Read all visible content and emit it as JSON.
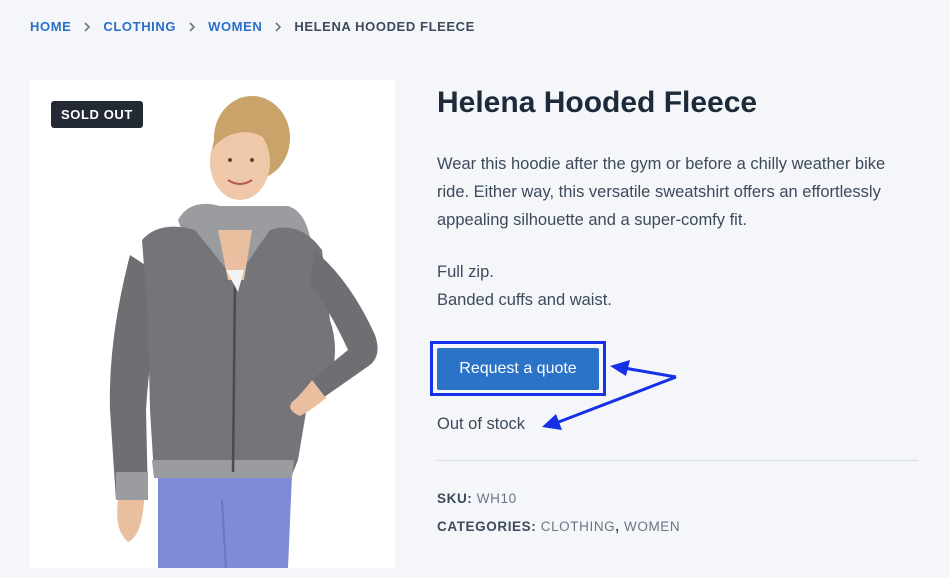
{
  "breadcrumb": {
    "items": [
      "HOME",
      "CLOTHING",
      "WOMEN"
    ],
    "current": "HELENA HOODED FLEECE"
  },
  "product": {
    "badge": "SOLD OUT",
    "title": "Helena Hooded Fleece",
    "description": "Wear this hoodie after the gym or before a chilly weather bike ride. Either way, this versatile sweatshirt offers an effortlessly appealing silhouette and a super-comfy fit.",
    "features": [
      "Full zip.",
      "Banded cuffs and waist."
    ],
    "quote_button": "Request a quote",
    "stock_status": "Out of stock",
    "sku_label": "SKU:",
    "sku_value": "WH10",
    "categories_label": "CATEGORIES:",
    "categories": [
      "CLOTHING",
      "WOMEN"
    ],
    "categories_sep": ","
  },
  "colors": {
    "link": "#2a6fc9",
    "button": "#2b73c6",
    "highlight": "#1530e6",
    "badge": "#232a33"
  }
}
